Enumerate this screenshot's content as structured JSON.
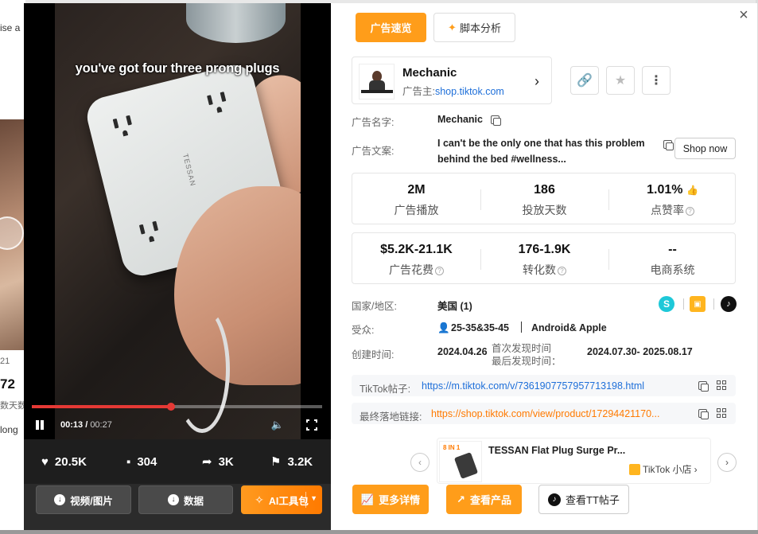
{
  "background": {
    "left_texts": [
      "ise a",
      "21",
      "72",
      "数天数",
      "long"
    ]
  },
  "video": {
    "caption": "you've got four three prong plugs",
    "current_time": "00:13",
    "duration": "00:27",
    "progress_fraction": 0.48,
    "brand_on_device": "TESSAN",
    "stats": {
      "likes": "20.5K",
      "comments": "304",
      "shares": "3K",
      "saves": "3.2K"
    },
    "actions": {
      "video_image": "视频/图片",
      "data": "数据",
      "ai_tools": "AI工具包"
    }
  },
  "detail": {
    "tabs": {
      "ad_overview": "广告速览",
      "script_analysis": "脚本分析"
    },
    "advertiser": {
      "name": "Mechanic",
      "label": "广告主:",
      "domain": "shop.tiktok.com"
    },
    "ad_name_label": "广告名字:",
    "ad_name": "Mechanic",
    "ad_copy_label": "广告文案:",
    "ad_copy": "I can't be the only one that has this problem behind the bed #wellness...",
    "cta": "Shop now",
    "metrics_row1": [
      {
        "value": "2M",
        "caption": "广告播放"
      },
      {
        "value": "186",
        "caption": "投放天数"
      },
      {
        "value": "1.01%",
        "caption": "点赞率"
      }
    ],
    "metrics_row2": [
      {
        "value": "$5.2K-21.1K",
        "caption": "广告花费"
      },
      {
        "value": "176-1.9K",
        "caption": "转化数"
      },
      {
        "value": "--",
        "caption": "电商系统"
      }
    ],
    "country_label": "国家/地区:",
    "country": "美国 (1)",
    "audience_label": "受众:",
    "audience_age": "25-35&35-45",
    "audience_platform": "Android& Apple",
    "created_label": "创建时间:",
    "created": "2024.04.26",
    "first_seen_label": "首次发现时间",
    "last_seen_label": "最后发现时间：",
    "seen_range": "2024.07.30- 2025.08.17",
    "tiktok_post_label": "TikTok帖子:",
    "tiktok_post_url": "https://m.tiktok.com/v/7361907757957713198.html",
    "landing_label": "最终落地链接:",
    "landing_url": "https://shop.tiktok.com/view/product/17294421170...",
    "product": {
      "title": "TESSAN Flat Plug Surge Pr...",
      "shop": "TikTok 小店",
      "thumb_tag": "8 IN 1"
    },
    "footer": {
      "more_details": "更多详情",
      "view_product": "查看产品",
      "view_tt_post": "查看TT帖子"
    },
    "colors": {
      "accent": "#ff9d1a",
      "link": "#1e6fd9",
      "landing_link": "#ff7a00"
    }
  }
}
